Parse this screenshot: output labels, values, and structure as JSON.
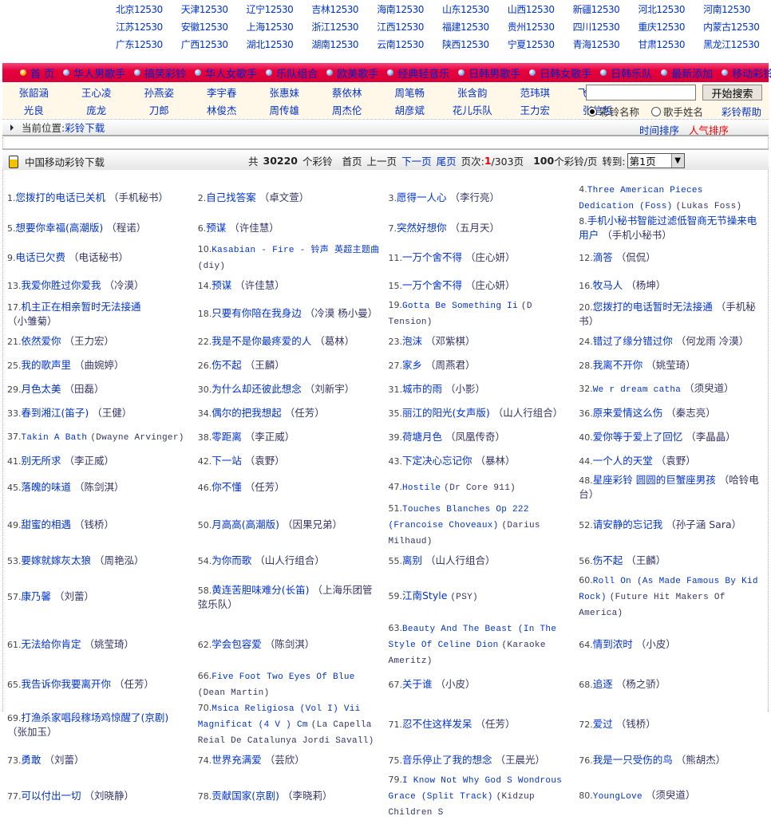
{
  "provinces": [
    [
      "北京12530",
      "天津12530",
      "辽宁12530",
      "吉林12530",
      "海南12530",
      "山东12530",
      "山西12530",
      "新疆12530",
      "河北12530",
      "河南12530"
    ],
    [
      "江苏12530",
      "安徽12530",
      "上海12530",
      "浙江12530",
      "江西12530",
      "福建12530",
      "贵州12530",
      "四川12530",
      "重庆12530",
      "内蒙古12530"
    ],
    [
      "广东12530",
      "广西12530",
      "湖北12530",
      "湖南12530",
      "云南12530",
      "陕西12530",
      "宁夏12530",
      "青海12530",
      "甘肃12530",
      "黑龙江12530"
    ]
  ],
  "nav": [
    "首 页",
    "华人男歌手",
    "搞笑彩铃",
    "华人女歌手",
    "乐队组合",
    "欧美歌手",
    "经典轻音乐",
    "日韩男歌手",
    "日韩女歌手",
    "日韩乐队",
    "最新添加",
    "移动彩铃"
  ],
  "artists": [
    [
      "张韶涵",
      "王心凌",
      "孙燕姿",
      "李宇春",
      "张惠妹",
      "蔡依林",
      "周笔畅",
      "张含韵",
      "范玮琪",
      "飞儿乐团"
    ],
    [
      "光良",
      "庞龙",
      "刀郎",
      "林俊杰",
      "周传雄",
      "周杰伦",
      "胡彦斌",
      "花儿乐队",
      "王力宏",
      "张信哲"
    ]
  ],
  "search": {
    "value": "",
    "button": "开始搜索",
    "radio1": "彩铃名称",
    "radio2": "歌手姓名",
    "help": "彩铃帮助"
  },
  "crumb": {
    "label": "当前位置:",
    "current": "彩铃下载",
    "sort_time": "时间排序",
    "sort_hot": "人气排序"
  },
  "header": {
    "title": "中国移动彩铃下载",
    "total_pre": "共",
    "total": "30220",
    "total_post": "个彩铃",
    "first": "首页",
    "prev": "上一页",
    "next": "下一页",
    "last": "尾页",
    "page_label": "页次:",
    "page_cur": "1",
    "page_total": "/303页",
    "per_page_num": "100",
    "per_page": "个彩铃/页",
    "goto": "转到:",
    "select": "第1页"
  },
  "songs": [
    {
      "n": "1.",
      "t": "您拨打的电话已关机",
      "a": "（手机秘书）"
    },
    {
      "n": "2.",
      "t": "自己找答案",
      "a": "（卓文萱）"
    },
    {
      "n": "3.",
      "t": "愿得一人心",
      "a": "（李行亮）"
    },
    {
      "n": "4.",
      "t": "Three American Pieces Dedication (Foss)",
      "a": "(Lukas Foss)"
    },
    {
      "n": "5.",
      "t": "想要你幸福(高潮版)",
      "a": "（程诺）"
    },
    {
      "n": "6.",
      "t": "预谋",
      "a": "（许佳慧）"
    },
    {
      "n": "7.",
      "t": "突然好想你",
      "a": "（五月天）"
    },
    {
      "n": "8.",
      "t": "手机小秘书智能过滤低智商无节操来电用户",
      "a": "（手机小秘书）"
    },
    {
      "n": "9.",
      "t": "电话已欠费",
      "a": "（电话秘书）"
    },
    {
      "n": "10.",
      "t": "Kasabian - Fire - 铃声 英超主题曲",
      "a": "(diy)"
    },
    {
      "n": "11.",
      "t": "一万个舍不得",
      "a": "（庄心妍）"
    },
    {
      "n": "12.",
      "t": "滴答",
      "a": "（侃侃）"
    },
    {
      "n": "13.",
      "t": "我爱你胜过你爱我",
      "a": "（冷漠）"
    },
    {
      "n": "14.",
      "t": "预谋",
      "a": "（许佳慧）"
    },
    {
      "n": "15.",
      "t": "一万个舍不得",
      "a": "（庄心妍）"
    },
    {
      "n": "16.",
      "t": "牧马人",
      "a": "（杨坤）"
    },
    {
      "n": "17.",
      "t": "机主正在相亲暂时无法接通",
      "a": "（小雏菊）"
    },
    {
      "n": "18.",
      "t": "只要有你陪在我身边",
      "a": "（冷漠 杨小曼）"
    },
    {
      "n": "19.",
      "t": "Gotta Be Something Ii",
      "a": "(D Tension)"
    },
    {
      "n": "20.",
      "t": "您拨打的电话暂时无法接通",
      "a": "（手机秘书）"
    },
    {
      "n": "21.",
      "t": "依然爱你",
      "a": "（王力宏）"
    },
    {
      "n": "22.",
      "t": "我是不是你最疼爱的人",
      "a": "（葛林）"
    },
    {
      "n": "23.",
      "t": "泡沫",
      "a": "（邓紫棋）"
    },
    {
      "n": "24.",
      "t": "错过了缘分错过你",
      "a": "（何龙雨 冷漠）"
    },
    {
      "n": "25.",
      "t": "我的歌声里",
      "a": "（曲婉婷）"
    },
    {
      "n": "26.",
      "t": "伤不起",
      "a": "（王麟）"
    },
    {
      "n": "27.",
      "t": "家乡",
      "a": "（周燕君）"
    },
    {
      "n": "28.",
      "t": "我离不开你",
      "a": "（姚莹琦）"
    },
    {
      "n": "29.",
      "t": "月色太美",
      "a": "（田磊）"
    },
    {
      "n": "30.",
      "t": "为什么却还彼此想念",
      "a": "（刘新宇）"
    },
    {
      "n": "31.",
      "t": "城市的雨",
      "a": "（小影）"
    },
    {
      "n": "32.",
      "t": "We r dream catha",
      "a": "（须臾道）"
    },
    {
      "n": "33.",
      "t": "春到湘江(笛子)",
      "a": "（王健）"
    },
    {
      "n": "34.",
      "t": "偶尔的把我想起",
      "a": "（任芳）"
    },
    {
      "n": "35.",
      "t": "丽江的阳光(女声版)",
      "a": "（山人行组合）"
    },
    {
      "n": "36.",
      "t": "原来爱情这么伤",
      "a": "（秦志亮）"
    },
    {
      "n": "37.",
      "t": "Takin A Bath",
      "a": "(Dwayne Arvinger)"
    },
    {
      "n": "38.",
      "t": "零距离",
      "a": "（李正威）"
    },
    {
      "n": "39.",
      "t": "荷塘月色",
      "a": "（凤凰传奇）"
    },
    {
      "n": "40.",
      "t": "爱你等于爱上了回忆",
      "a": "（李晶晶）"
    },
    {
      "n": "41.",
      "t": "别无所求",
      "a": "（李正威）"
    },
    {
      "n": "42.",
      "t": "下一站",
      "a": "（袁野）"
    },
    {
      "n": "43.",
      "t": "下定决心忘记你",
      "a": "（暴林）"
    },
    {
      "n": "44.",
      "t": "一个人的天堂",
      "a": "（袁野）"
    },
    {
      "n": "45.",
      "t": "落魄的味道",
      "a": "（陈剑淇）"
    },
    {
      "n": "46.",
      "t": "你不懂",
      "a": "（任芳）"
    },
    {
      "n": "47.",
      "t": "Hostile",
      "a": "(Dr Core 911)"
    },
    {
      "n": "48.",
      "t": "星座彩铃 圆圆的巨蟹座男孩",
      "a": "（哈铃电台）"
    },
    {
      "n": "49.",
      "t": "甜蜜的相遇",
      "a": "（钱桥）"
    },
    {
      "n": "50.",
      "t": "月高高(高潮版)",
      "a": "（因果兄弟）"
    },
    {
      "n": "51.",
      "t": "Touches Blanches Op 222 (Francoise Choveaux)",
      "a": "(Darius Milhaud)"
    },
    {
      "n": "52.",
      "t": "请安静的忘记我",
      "a": "（孙子涵 Sara）"
    },
    {
      "n": "53.",
      "t": "要嫁就嫁灰太狼",
      "a": "（周艳泓）"
    },
    {
      "n": "54.",
      "t": "为你而歌",
      "a": "（山人行组合）"
    },
    {
      "n": "55.",
      "t": "离别",
      "a": "（山人行组合）"
    },
    {
      "n": "56.",
      "t": "伤不起",
      "a": "（王麟）"
    },
    {
      "n": "57.",
      "t": "康乃馨",
      "a": "（刘蕾）"
    },
    {
      "n": "58.",
      "t": "黄连苦胆味难分(长笛)",
      "a": "（上海乐团管弦乐队）"
    },
    {
      "n": "59.",
      "t": "江南Style",
      "a": "(PSY)"
    },
    {
      "n": "60.",
      "t": "Roll On (As Made Famous By Kid Rock)",
      "a": "(Future Hit Makers Of America)"
    },
    {
      "n": "61.",
      "t": "无法给你肯定",
      "a": "（姚莹琦）"
    },
    {
      "n": "62.",
      "t": "学会包容爱",
      "a": "（陈剑淇）"
    },
    {
      "n": "63.",
      "t": "Beauty And The Beast (In The Style Of Celine Dion",
      "a": "(Karaoke Ameritz)"
    },
    {
      "n": "64.",
      "t": "情到浓时",
      "a": "（小皮）"
    },
    {
      "n": "65.",
      "t": "我告诉你我要离开你",
      "a": "（任芳）"
    },
    {
      "n": "66.",
      "t": "Five Foot Two Eyes Of Blue",
      "a": "(Dean Martin)"
    },
    {
      "n": "67.",
      "t": "关于谁",
      "a": "（小皮）"
    },
    {
      "n": "68.",
      "t": "追逐",
      "a": "（杨之骄）"
    },
    {
      "n": "69.",
      "t": "打渔杀家唱段稼场鸡惊醒了(京剧)",
      "a": "（张加玉）"
    },
    {
      "n": "70.",
      "t": "Msica Religiosa (Vol I) Vii Magnificat (4 V ) Cm",
      "a": "(La Capella Reial De Catalunya Jordi Savall)"
    },
    {
      "n": "71.",
      "t": "忍不住这样发呆",
      "a": "（任芳）"
    },
    {
      "n": "72.",
      "t": "爱过",
      "a": "（钱桥）"
    },
    {
      "n": "73.",
      "t": "勇敢",
      "a": "（刘蕾）"
    },
    {
      "n": "74.",
      "t": "世界充满爱",
      "a": "（芸欣）"
    },
    {
      "n": "75.",
      "t": "音乐停止了我的想念",
      "a": "（王晨光）"
    },
    {
      "n": "76.",
      "t": "我是一只受伤的鸟",
      "a": "（熊胡杰）"
    },
    {
      "n": "77.",
      "t": "可以付出一切",
      "a": "（刘晓静）"
    },
    {
      "n": "78.",
      "t": "贡献国家(京剧)",
      "a": "（李晓莉）"
    },
    {
      "n": "79.",
      "t": "I Know Not Why God S Wondrous Grace (Split Track)",
      "a": "(Kidzup Children S"
    },
    {
      "n": "80.",
      "t": "YoungLove",
      "a": "（须臾道）"
    }
  ]
}
